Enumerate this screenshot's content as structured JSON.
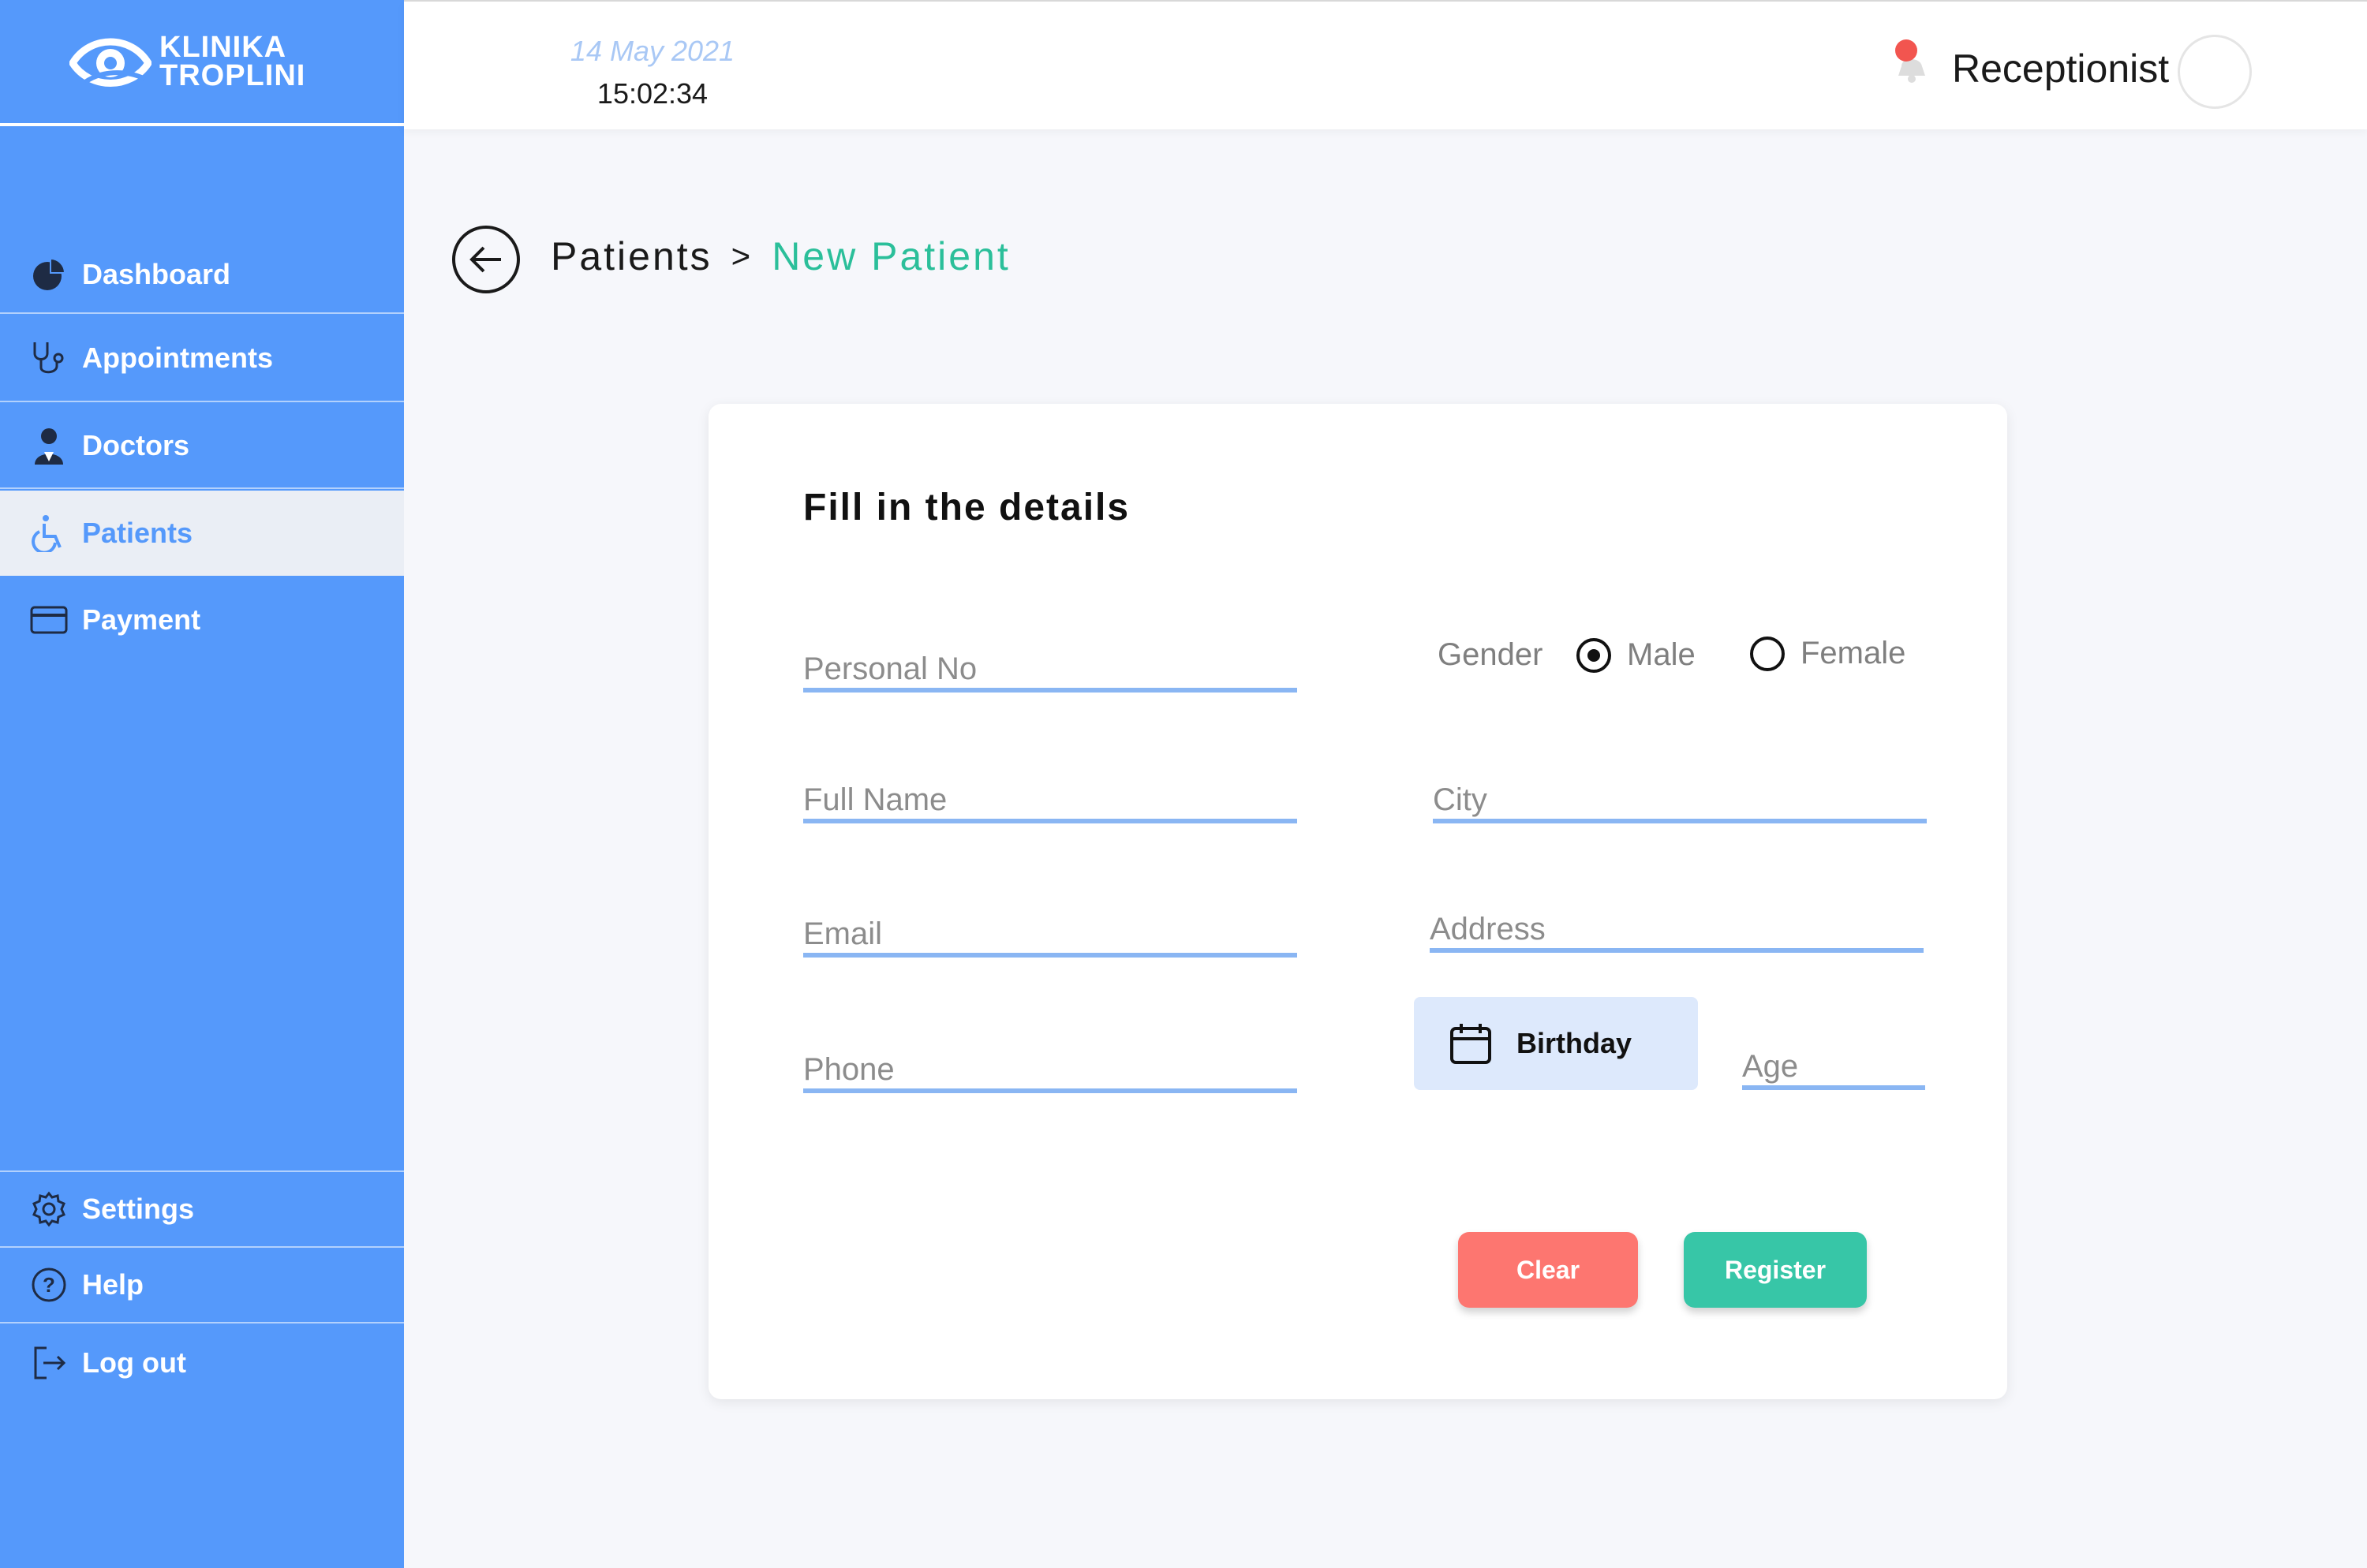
{
  "brand": {
    "line1": "KLINIKA",
    "line2": "TROPLINI"
  },
  "sidebar": {
    "items": [
      {
        "label": "Dashboard",
        "icon": "pie-chart-icon"
      },
      {
        "label": "Appointments",
        "icon": "stethoscope-icon"
      },
      {
        "label": "Doctors",
        "icon": "doctor-icon"
      },
      {
        "label": "Patients",
        "icon": "wheelchair-icon",
        "active": true
      },
      {
        "label": "Payment",
        "icon": "credit-card-icon"
      }
    ],
    "bottom_items": [
      {
        "label": "Settings",
        "icon": "gear-icon"
      },
      {
        "label": "Help",
        "icon": "help-icon"
      },
      {
        "label": "Log out",
        "icon": "logout-icon"
      }
    ]
  },
  "header": {
    "date": "14 May 2021",
    "time": "15:02:34",
    "role": "Receptionist"
  },
  "breadcrumb": {
    "parent": "Patients",
    "separator": ">",
    "current": "New Patient"
  },
  "form": {
    "title": "Fill in the details",
    "fields": {
      "personal_no": {
        "placeholder": "Personal No",
        "value": ""
      },
      "full_name": {
        "placeholder": "Full Name",
        "value": ""
      },
      "email": {
        "placeholder": "Email",
        "value": ""
      },
      "phone": {
        "placeholder": "Phone",
        "value": ""
      },
      "city": {
        "placeholder": "City",
        "value": ""
      },
      "address": {
        "placeholder": "Address",
        "value": ""
      },
      "age": {
        "placeholder": "Age",
        "value": ""
      }
    },
    "gender": {
      "label": "Gender",
      "options": [
        "Male",
        "Female"
      ],
      "selected": "Male"
    },
    "birthday_label": "Birthday",
    "buttons": {
      "clear": "Clear",
      "register": "Register"
    }
  },
  "colors": {
    "sidebar": "#5599fb",
    "accent_green": "#37c6a7",
    "danger": "#fd7670",
    "underline": "#8ab6f3"
  }
}
